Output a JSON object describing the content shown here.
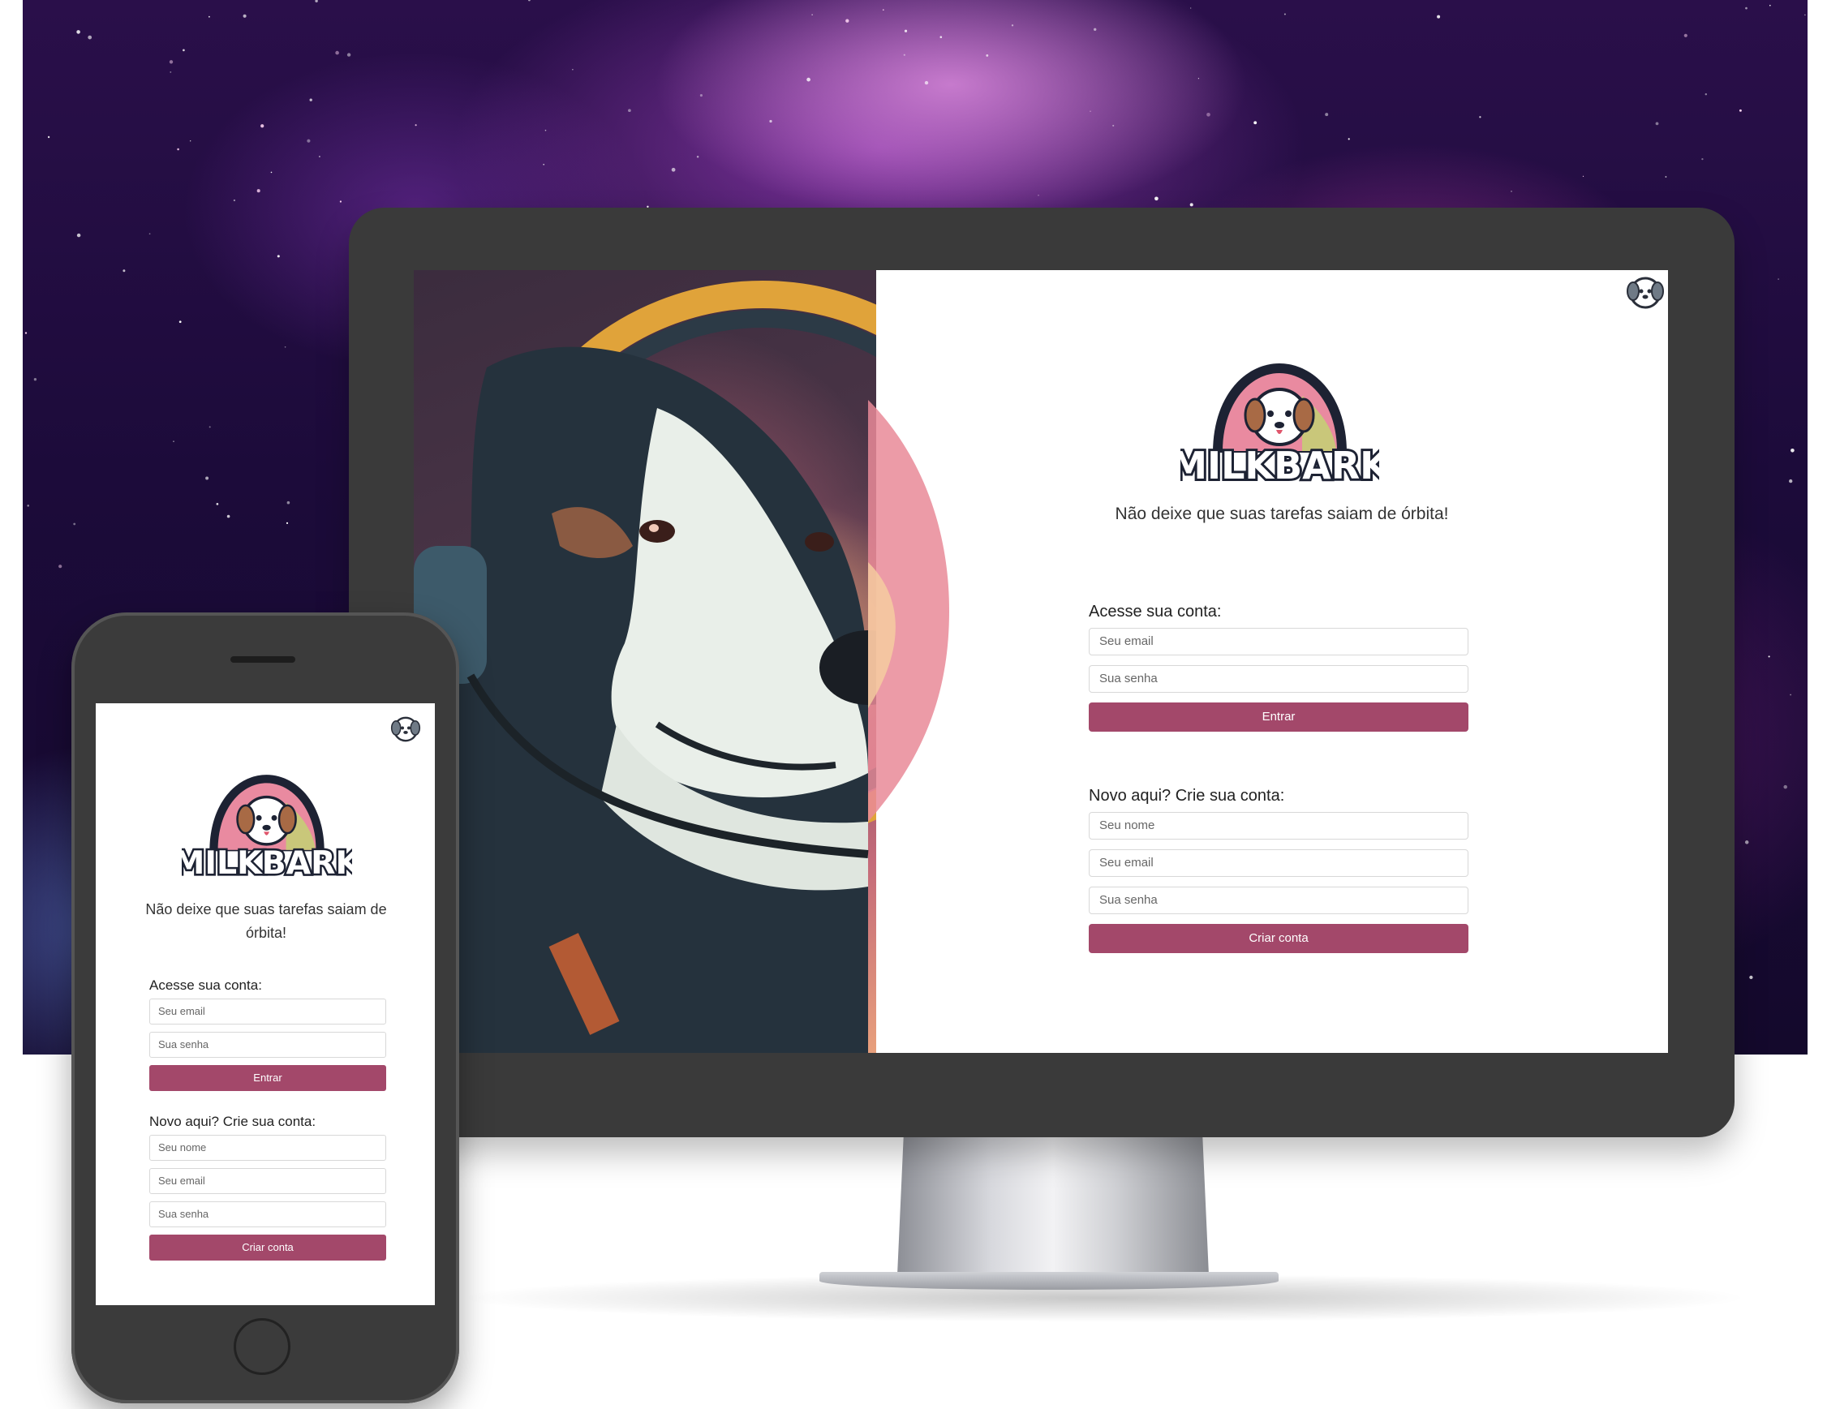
{
  "brand": {
    "name": "MILKBARK",
    "tagline": "Não deixe que suas tarefas saiam de órbita!",
    "accent_color": "#a3486a"
  },
  "desktop": {
    "login": {
      "heading": "Acesse sua conta:",
      "email_placeholder": "Seu email",
      "password_placeholder": "Sua senha",
      "submit_label": "Entrar"
    },
    "signup": {
      "heading": "Novo aqui? Crie sua conta:",
      "name_placeholder": "Seu nome",
      "email_placeholder": "Seu email",
      "password_placeholder": "Sua senha",
      "submit_label": "Criar conta"
    },
    "hero_image": "astronaut-dog-illustration",
    "avatar_icon": "dog-avatar-icon"
  },
  "mobile": {
    "tagline": "Não deixe que suas tarefas saiam de órbita!",
    "login": {
      "heading": "Acesse sua conta:",
      "email_placeholder": "Seu email",
      "password_placeholder": "Sua senha",
      "submit_label": "Entrar"
    },
    "signup": {
      "heading": "Novo aqui? Crie sua conta:",
      "name_placeholder": "Seu nome",
      "email_placeholder": "Seu email",
      "password_placeholder": "Sua senha",
      "submit_label": "Criar conta"
    },
    "avatar_icon": "dog-avatar-icon"
  },
  "background": "galaxy-nebula"
}
